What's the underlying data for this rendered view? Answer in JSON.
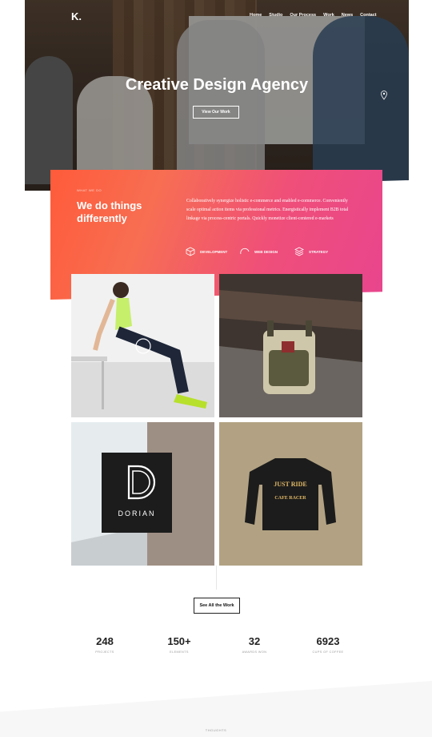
{
  "header": {
    "logo": "K.",
    "nav": [
      "Home",
      "Studio",
      "Our Process",
      "Work",
      "News",
      "Contact"
    ]
  },
  "hero": {
    "title": "Creative Design Agency",
    "button": "View Our Work"
  },
  "about": {
    "eyebrow": "WHAT WE DO",
    "title": "We do things differently",
    "text": "Collaboratively synergize holistic e-commerce and enabled e-commerce. Conveniently scale optimal action items via professional metrics. Energistically implement B2B total linkage via process-centric portals. Quickly monetize client-centered e-markets",
    "services": [
      {
        "label": "DEVELOPMENT",
        "icon": "cube-icon"
      },
      {
        "label": "WEB DESIGN",
        "icon": "arc-icon"
      },
      {
        "label": "STRATEGY",
        "icon": "layers-icon"
      }
    ]
  },
  "portfolio": {
    "items": [
      {
        "name": "fitness-woman"
      },
      {
        "name": "backpack",
        "brand": "TORUS"
      },
      {
        "name": "dorian-sign",
        "brand": "DORIAN"
      },
      {
        "name": "tshirt",
        "line1": "JUST RIDE",
        "line2": "CAFE RACER"
      }
    ],
    "button": "See All the Work"
  },
  "stats": [
    {
      "value": "248",
      "label": "PROJECTS"
    },
    {
      "value": "150+",
      "label": "ELEMENTS"
    },
    {
      "value": "32",
      "label": "AWARDS WON"
    },
    {
      "value": "6923",
      "label": "CUPS OF COFFEE"
    }
  ],
  "footer": {
    "thoughts": "THOUGHTS"
  },
  "colors": {
    "accent_start": "#ff5b3a",
    "accent_end": "#e8458e"
  }
}
